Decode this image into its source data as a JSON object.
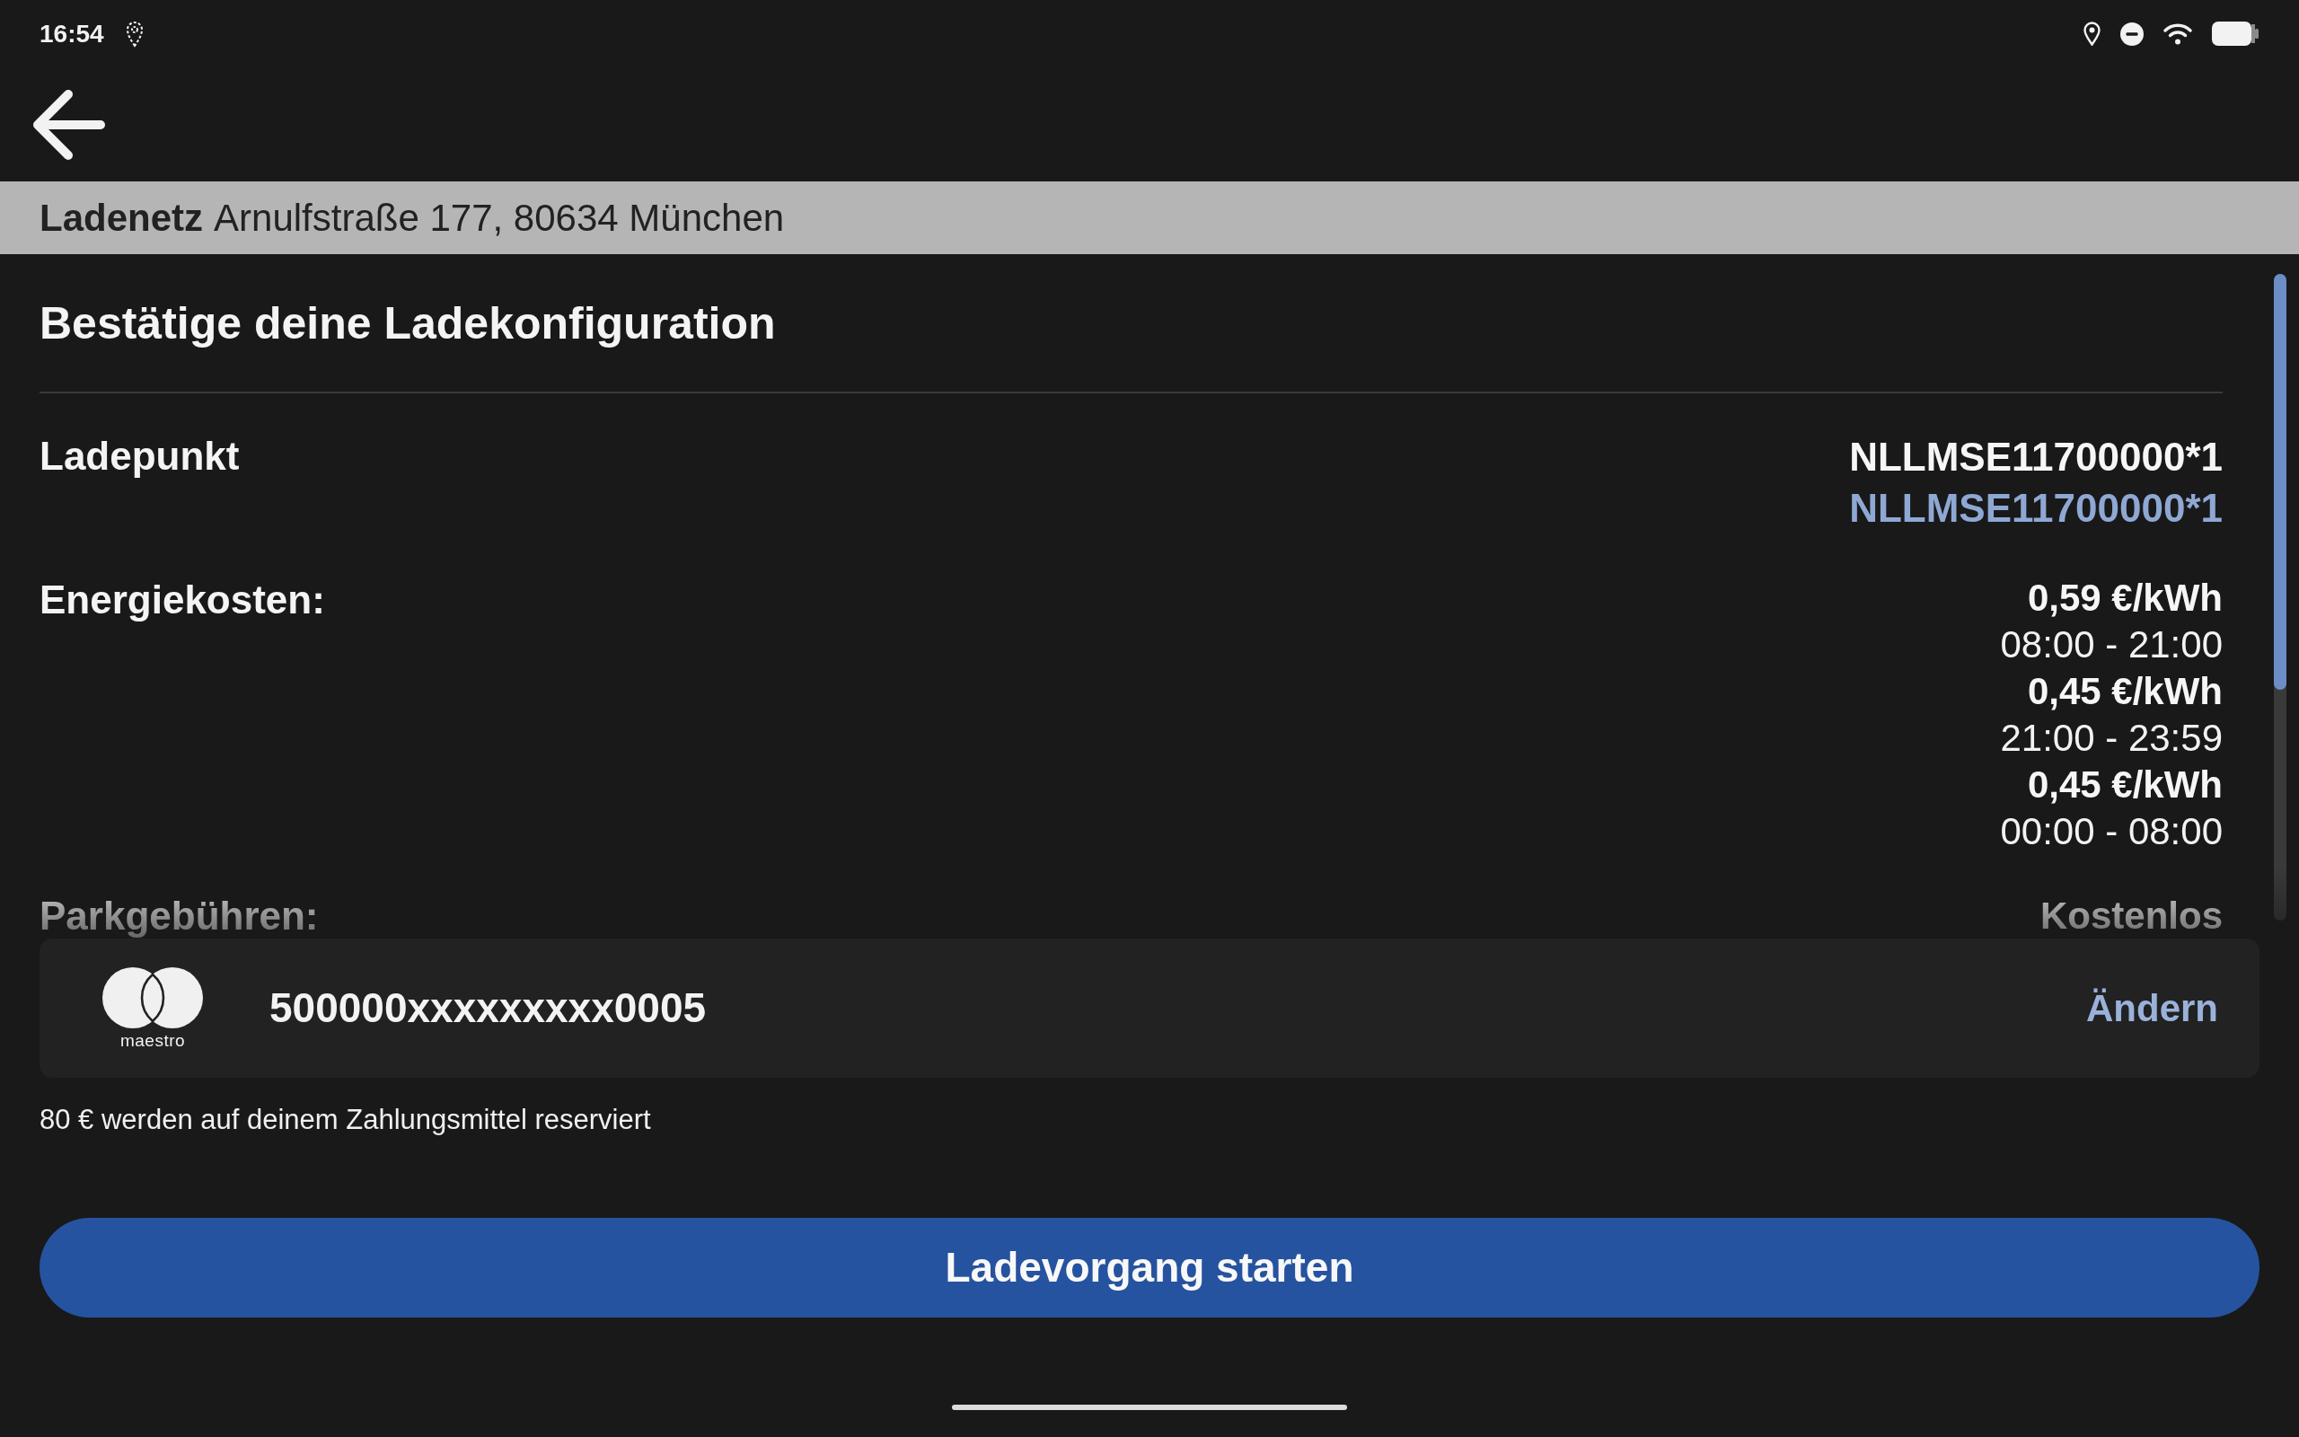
{
  "status_bar": {
    "time": "16:54"
  },
  "header": {
    "operator": "Ladenetz",
    "address": "Arnulfstraße 177, 80634 München"
  },
  "title": "Bestätige deine Ladekonfiguration",
  "details": [
    {
      "label": "Ladepunkt",
      "values": [
        {
          "text": "NLLMSE11700000*1",
          "kind": "primary"
        },
        {
          "text": "NLLMSE11700000*1",
          "kind": "accent"
        }
      ]
    },
    {
      "label": "Energiekosten:",
      "values": [
        {
          "text": "0,59 €/kWh",
          "kind": "price"
        },
        {
          "text": "08:00 - 21:00",
          "kind": "time"
        },
        {
          "text": "0,45 €/kWh",
          "kind": "price"
        },
        {
          "text": "21:00 - 23:59",
          "kind": "time"
        },
        {
          "text": "0,45 €/kWh",
          "kind": "price"
        },
        {
          "text": "00:00 - 08:00",
          "kind": "time"
        }
      ]
    },
    {
      "label": "Parkgebühren:",
      "values": [
        {
          "text": "Kostenlos",
          "kind": "price"
        }
      ]
    }
  ],
  "payment": {
    "brand_label": "maestro",
    "card_number": "500000xxxxxxxxx0005",
    "change_link": "Ändern"
  },
  "reservation_note": "80 € werden auf deinem Zahlungsmittel reserviert",
  "start_button": "Ladevorgang starten"
}
